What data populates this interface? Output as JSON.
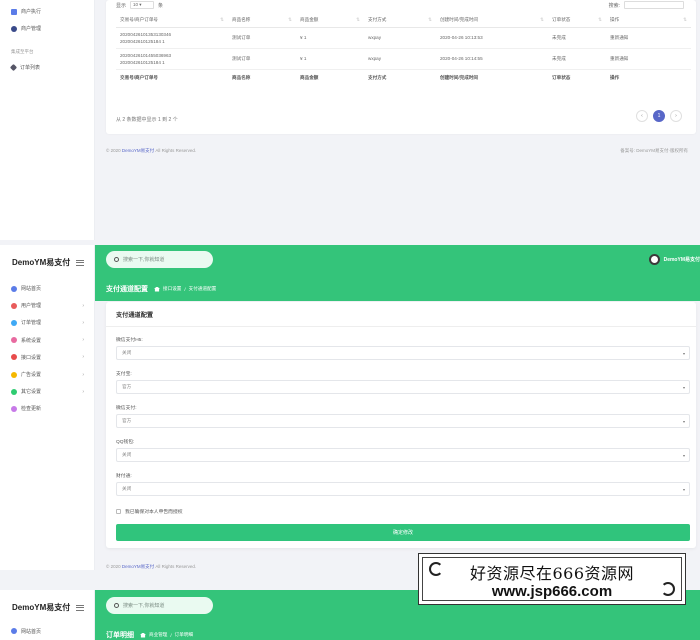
{
  "top_sidebar": {
    "items": [
      {
        "label": "商户执行",
        "icon": "bar-chart-icon",
        "color": "#5b7ce8"
      },
      {
        "label": "商户管理",
        "icon": "user-icon",
        "color": "#3a4a8a"
      }
    ],
    "section_label": "集成至平台",
    "extra_item": {
      "label": "订单列表",
      "icon": "gem-icon",
      "color": "#556"
    }
  },
  "orders_panel": {
    "show_label": "显示",
    "page_size": "10",
    "rows_label": "条",
    "search_label": "搜索:",
    "columns": [
      "交易号/商户订单号",
      "商品名称",
      "商品金额",
      "支付方式",
      "创建时间/完成时间",
      "订单状态",
      "操作"
    ],
    "rows": [
      {
        "trade_no": "20200426101353130346",
        "order_no": "2020042610125184 1",
        "name": "测试订单",
        "amount": "¥ 1",
        "method": "wxpay",
        "time": "2020-04-26 10:13:53",
        "status": "未完成",
        "op": "重新通知"
      },
      {
        "trade_no": "20200426101455036963",
        "order_no": "2020042610125184 1",
        "name": "测试订单",
        "amount": "¥ 1",
        "method": "wxpay",
        "time": "2020-04-26 10:14:55",
        "status": "未完成",
        "op": "重新通知"
      }
    ],
    "info": "从 2 条数据中显示 1 到 2 个",
    "pager": {
      "prev": "‹",
      "current": "1",
      "next": "›"
    }
  },
  "footer1": {
    "copy_prefix": "© 2020",
    "brand": "DemoYM易支付",
    "copy_suffix": "All Rights Reserved.",
    "right": "备案号: DemoYM易支付·版权所有"
  },
  "brand": "DemoYM易支付",
  "sidebar": {
    "items": [
      {
        "label": "网站首页",
        "icon": "globe-icon",
        "color": "#5b7ce8",
        "chevron": ""
      },
      {
        "label": "用户管理",
        "icon": "user-icon",
        "color": "#e85b5b",
        "chevron": "›"
      },
      {
        "label": "订单管理",
        "icon": "list-icon",
        "color": "#3fa9f5",
        "chevron": "›"
      },
      {
        "label": "系统设置",
        "icon": "link-icon",
        "color": "#e86aa0",
        "chevron": "›"
      },
      {
        "label": "接口设置",
        "icon": "plug-icon",
        "color": "#e84b4b",
        "chevron": "›"
      },
      {
        "label": "广告设置",
        "icon": "smile-icon",
        "color": "#f5b800",
        "chevron": "›"
      },
      {
        "label": "其它设置",
        "icon": "send-icon",
        "color": "#2ecc71",
        "chevron": "›"
      },
      {
        "label": "检查更新",
        "icon": "link-icon",
        "color": "#c77ae8",
        "chevron": ""
      }
    ]
  },
  "header": {
    "search_placeholder": "搜索一下,你就知道",
    "user_name": "DemoYM易支付",
    "accent": "#34c47a"
  },
  "page": {
    "title": "支付通道配置",
    "crumb_home": "接口设置",
    "crumb_sep": "/",
    "crumb_current": "支付通道配置"
  },
  "form": {
    "title": "支付通道配置",
    "fields": [
      {
        "label": "微信支付H5:",
        "value": "关闭"
      },
      {
        "label": "支付宝:",
        "value": "官方"
      },
      {
        "label": "微信支付:",
        "value": "官方"
      },
      {
        "label": "QQ钱包:",
        "value": "关闭"
      },
      {
        "label": "财付通:",
        "value": "关闭"
      }
    ],
    "checkbox_label": "我已确保对本人申告而授权",
    "submit_label": "确定修改"
  },
  "footer2": {
    "copy_prefix": "© 2020",
    "brand": "DemoYM易支付",
    "copy_suffix": "All Rights Reserved."
  },
  "bottom": {
    "brand": "DemoYM易支付",
    "search_placeholder": "搜索一下,你就知道",
    "first_item": "网站首页",
    "page_title": "订单明细",
    "crumb_home": "商业管理",
    "crumb_sep": "/",
    "crumb_current": "订单明细"
  },
  "watermark": {
    "line1": "好资源尽在666资源网",
    "line2": "www.jsp666.com"
  }
}
